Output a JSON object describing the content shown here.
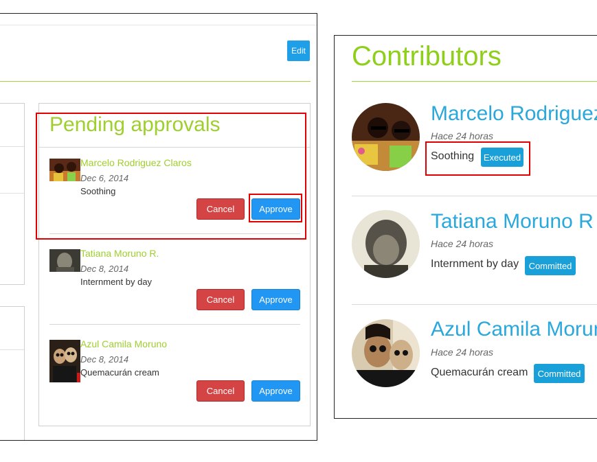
{
  "left": {
    "edit_label": "Edit",
    "pending_title": "Pending approvals",
    "cancel_label": "Cancel",
    "approve_label": "Approve",
    "items": [
      {
        "name": "Marcelo Rodriguez Claros",
        "date": "Dec 6, 2014",
        "desc": "Soothing"
      },
      {
        "name": "Tatiana Moruno R.",
        "date": "Dec 8, 2014",
        "desc": "Internment by day"
      },
      {
        "name": "Azul Camila Moruno",
        "date": "Dec 8, 2014",
        "desc": "Quemacurán cream"
      }
    ]
  },
  "right": {
    "title": "Contributors",
    "items": [
      {
        "name": "Marcelo Rodriguez",
        "time": "Hace 24 horas",
        "desc": "Soothing",
        "status": "Executed"
      },
      {
        "name": "Tatiana Moruno R",
        "time": "Hace 24 horas",
        "desc": "Internment by day",
        "status": "Committed"
      },
      {
        "name": "Azul Camila Morun",
        "time": "Hace 24 horas",
        "desc": "Quemacurán cream",
        "status": "Committed"
      }
    ]
  },
  "colors": {
    "accent_green": "#9ecf2c",
    "accent_blue": "#29a8dc",
    "approve_blue": "#2196f3",
    "cancel_red": "#d54444",
    "highlight_red": "#e00000"
  }
}
